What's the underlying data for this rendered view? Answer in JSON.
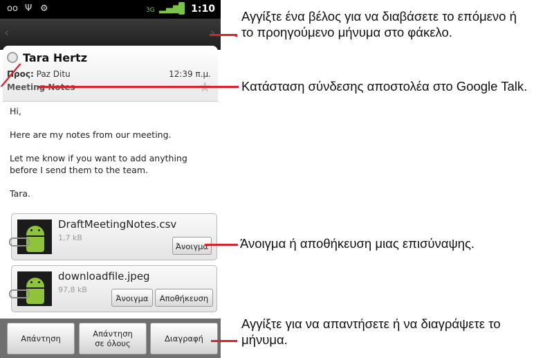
{
  "status_bar": {
    "time": "1:10",
    "icons": [
      "voicemail-icon",
      "usb-icon",
      "android-debug-icon",
      "3g-icon",
      "signal-icon",
      "battery-icon"
    ]
  },
  "nav": {
    "prev": "‹",
    "next": "›"
  },
  "header": {
    "sender": "Tara Hertz",
    "to_label": "Προς:",
    "to_value": "Paz Ditu",
    "time": "12:39 π.μ.",
    "subject": "Meeting Notes",
    "star": "★"
  },
  "body": {
    "lines": [
      "Hi,",
      "Here are my notes from our meeting.",
      "Let me know if you want to add anything before I send them to the team.",
      "Tara."
    ]
  },
  "attachments": [
    {
      "name": "DraftMeetingNotes.csv",
      "size": "1,7 kB",
      "open": "Άνοιγμα"
    },
    {
      "name": "downloadfile.jpeg",
      "size": "97,8 kB",
      "open": "Άνοιγμα",
      "save": "Αποθήκευση"
    }
  ],
  "bottom": {
    "reply": "Απάντηση",
    "reply_all_1": "Απάντηση",
    "reply_all_2": "σε όλους",
    "delete": "Διαγραφή"
  },
  "annotations": {
    "nav": "Αγγίξτε ένα βέλος για να διαβάσετε το επόμενο ή το προηγούμενο μήνυμα στο φάκελο.",
    "presence": "Κατάσταση σύνδεσης αποστολέα στο Google Talk.",
    "attachment": "Άνοιγμα ή αποθήκευση μιας επισύναψης.",
    "reply": "Αγγίξτε για να απαντήσετε ή να διαγράψετε το μήνυμα."
  },
  "colors": {
    "callout": "#d8232a",
    "android_green": "#8fc33b"
  }
}
